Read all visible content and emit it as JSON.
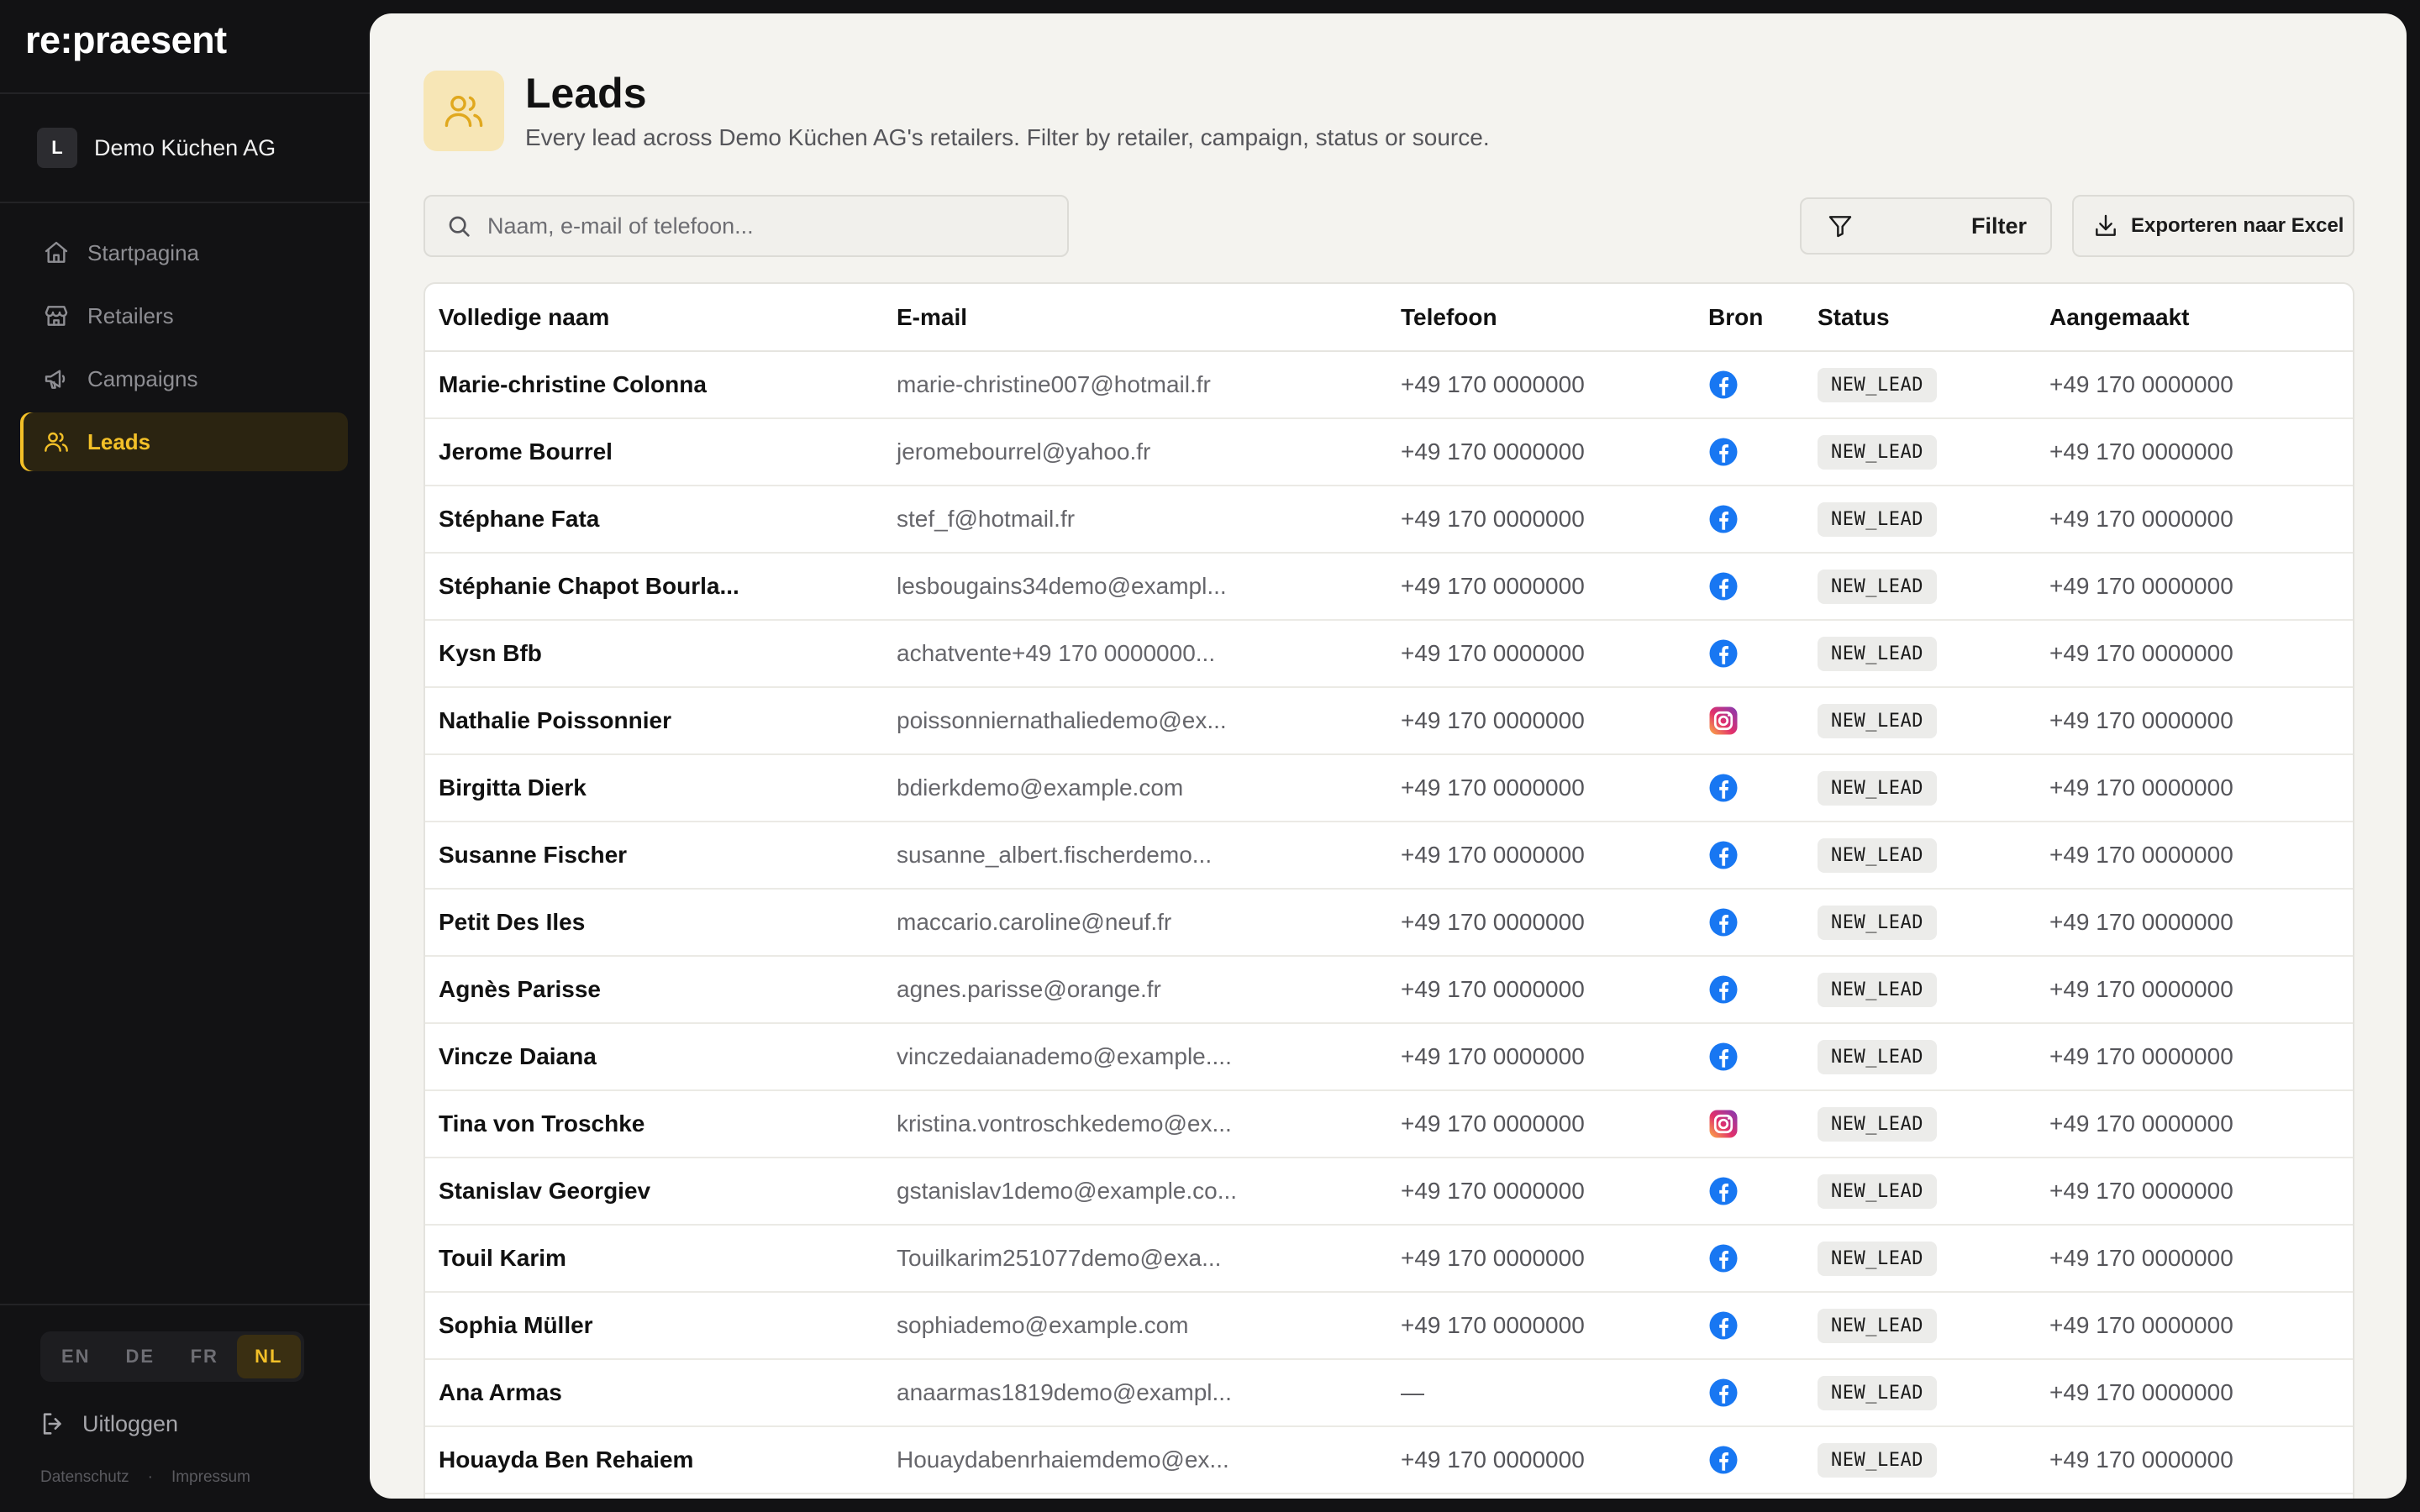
{
  "app": {
    "brand": "re:praesent"
  },
  "org": {
    "initial": "L",
    "name": "Demo Küchen AG"
  },
  "nav": [
    {
      "label": "Startpagina",
      "icon": "home-icon"
    },
    {
      "label": "Retailers",
      "icon": "store-icon"
    },
    {
      "label": "Campaigns",
      "icon": "megaphone-icon"
    },
    {
      "label": "Leads",
      "icon": "users-icon",
      "active": true
    }
  ],
  "languages": [
    "EN",
    "DE",
    "FR",
    "NL"
  ],
  "active_language": "NL",
  "logout_label": "Uitloggen",
  "legal": {
    "privacy": "Datenschutz",
    "separator": "·",
    "imprint": "Impressum"
  },
  "page": {
    "title": "Leads",
    "subtitle": "Every lead across Demo Küchen AG's retailers. Filter by retailer, campaign, status or source."
  },
  "search": {
    "placeholder": "Naam, e-mail of telefoon...",
    "value": ""
  },
  "filter_label": "Filter",
  "export_label": "Exporteren naar Excel",
  "colors": {
    "accent": "#f3c028",
    "facebook": "#1877f2"
  },
  "table": {
    "columns": [
      "Volledige naam",
      "E-mail",
      "Telefoon",
      "Bron",
      "Status",
      "Aangemaakt"
    ],
    "rows": [
      {
        "name": "Marie-christine Colonna",
        "email": "marie-christine007@hotmail.fr",
        "phone": "+49 170 0000000",
        "source": "facebook",
        "status": "NEW_LEAD",
        "created": "+49 170 0000000"
      },
      {
        "name": "Jerome Bourrel",
        "email": "jeromebourrel@yahoo.fr",
        "phone": "+49 170 0000000",
        "source": "facebook",
        "status": "NEW_LEAD",
        "created": "+49 170 0000000"
      },
      {
        "name": "Stéphane Fata",
        "email": "stef_f@hotmail.fr",
        "phone": "+49 170 0000000",
        "source": "facebook",
        "status": "NEW_LEAD",
        "created": "+49 170 0000000"
      },
      {
        "name": "Stéphanie Chapot Bourla...",
        "email": "lesbougains34demo@exampl...",
        "phone": "+49 170 0000000",
        "source": "facebook",
        "status": "NEW_LEAD",
        "created": "+49 170 0000000"
      },
      {
        "name": "Kysn Bfb",
        "email": "achatvente+49 170 0000000...",
        "phone": "+49 170 0000000",
        "source": "facebook",
        "status": "NEW_LEAD",
        "created": "+49 170 0000000"
      },
      {
        "name": "Nathalie Poissonnier",
        "email": "poissonniernathaliedemo@ex...",
        "phone": "+49 170 0000000",
        "source": "instagram",
        "status": "NEW_LEAD",
        "created": "+49 170 0000000"
      },
      {
        "name": "Birgitta Dierk",
        "email": "bdierkdemo@example.com",
        "phone": "+49 170 0000000",
        "source": "facebook",
        "status": "NEW_LEAD",
        "created": "+49 170 0000000"
      },
      {
        "name": "Susanne Fischer",
        "email": "susanne_albert.fischerdemo...",
        "phone": "+49 170 0000000",
        "source": "facebook",
        "status": "NEW_LEAD",
        "created": "+49 170 0000000"
      },
      {
        "name": "Petit Des Iles",
        "email": "maccario.caroline@neuf.fr",
        "phone": "+49 170 0000000",
        "source": "facebook",
        "status": "NEW_LEAD",
        "created": "+49 170 0000000"
      },
      {
        "name": "Agnès Parisse",
        "email": "agnes.parisse@orange.fr",
        "phone": "+49 170 0000000",
        "source": "facebook",
        "status": "NEW_LEAD",
        "created": "+49 170 0000000"
      },
      {
        "name": "Vincze Daiana",
        "email": "vinczedaianademo@example....",
        "phone": "+49 170 0000000",
        "source": "facebook",
        "status": "NEW_LEAD",
        "created": "+49 170 0000000"
      },
      {
        "name": "Tina von Troschke",
        "email": "kristina.vontroschkedemo@ex...",
        "phone": "+49 170 0000000",
        "source": "instagram",
        "status": "NEW_LEAD",
        "created": "+49 170 0000000"
      },
      {
        "name": "Stanislav Georgiev",
        "email": "gstanislav1demo@example.co...",
        "phone": "+49 170 0000000",
        "source": "facebook",
        "status": "NEW_LEAD",
        "created": "+49 170 0000000"
      },
      {
        "name": "Touil Karim",
        "email": "Touilkarim251077demo@exa...",
        "phone": "+49 170 0000000",
        "source": "facebook",
        "status": "NEW_LEAD",
        "created": "+49 170 0000000"
      },
      {
        "name": "Sophia Müller",
        "email": "sophiademo@example.com",
        "phone": "+49 170 0000000",
        "source": "facebook",
        "status": "NEW_LEAD",
        "created": "+49 170 0000000"
      },
      {
        "name": "Ana Armas",
        "email": "anaarmas1819demo@exampl...",
        "phone": "—",
        "source": "facebook",
        "status": "NEW_LEAD",
        "created": "+49 170 0000000"
      },
      {
        "name": "Houayda Ben Rehaiem",
        "email": "Houaydabenrhaiemdemo@ex...",
        "phone": "+49 170 0000000",
        "source": "facebook",
        "status": "NEW_LEAD",
        "created": "+49 170 0000000"
      }
    ]
  }
}
